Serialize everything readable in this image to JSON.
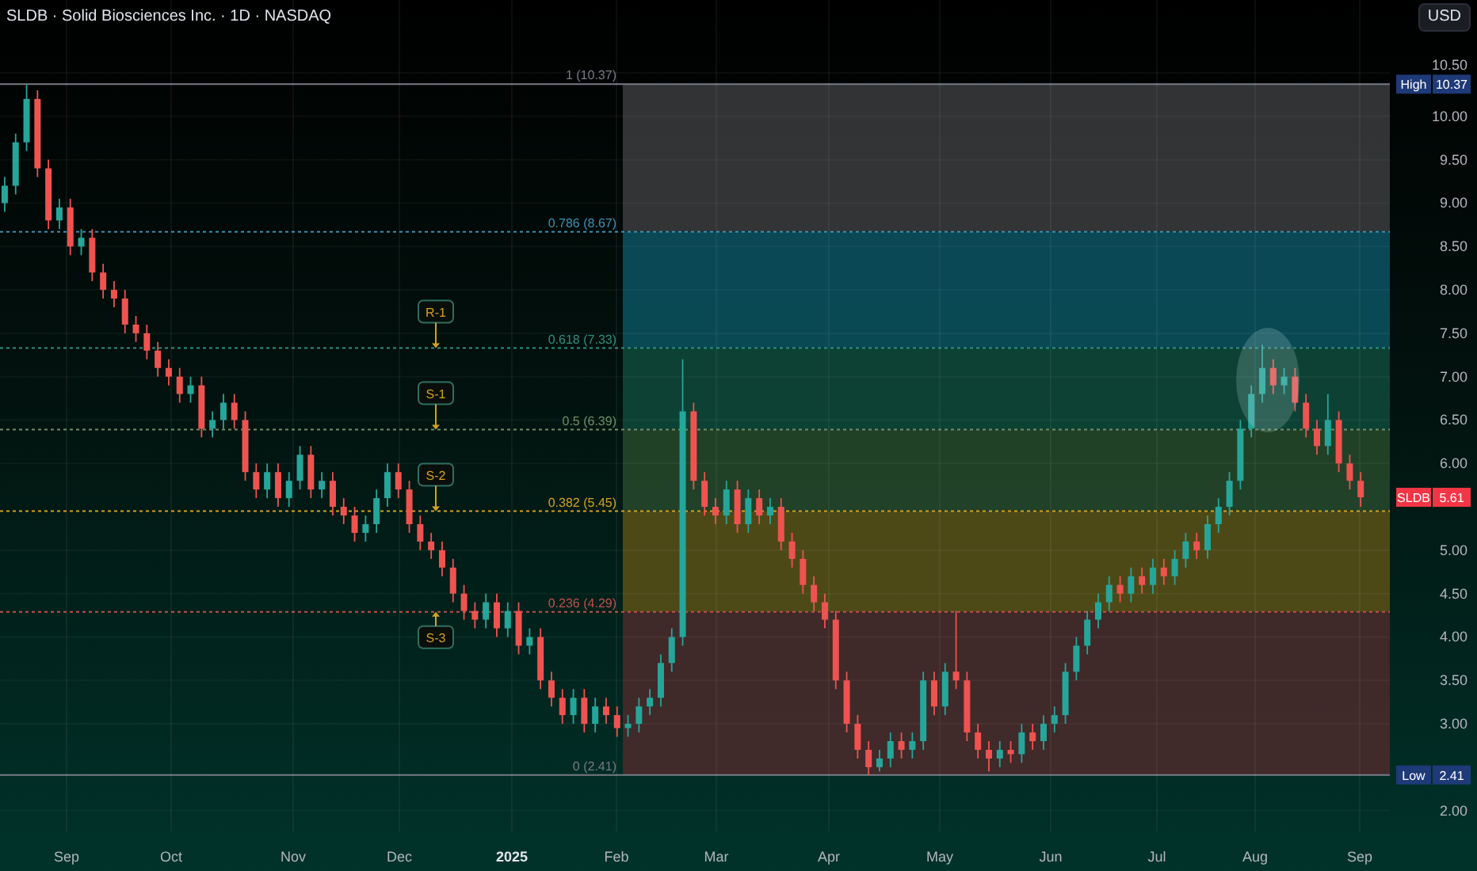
{
  "header": {
    "title": "SLDB · Solid Biosciences Inc. · 1D · NASDAQ",
    "currency_button": "USD"
  },
  "fib_levels": [
    {
      "label": "1 (10.37)",
      "color": "#787b86"
    },
    {
      "label": "0.786 (8.67)",
      "color": "#3d8fb3"
    },
    {
      "label": "0.618 (7.33)",
      "color": "#2f8f7f"
    },
    {
      "label": "0.5 (6.39)",
      "color": "#6f8f6a"
    },
    {
      "label": "0.382 (5.45)",
      "color": "#d3a21f"
    },
    {
      "label": "0.236 (4.29)",
      "color": "#c0504d"
    },
    {
      "label": "0 (2.41)",
      "color": "#787b86"
    }
  ],
  "level_tags": [
    {
      "label": "R-1",
      "arrow_up": false
    },
    {
      "label": "S-1",
      "arrow_up": false
    },
    {
      "label": "S-2",
      "arrow_up": false
    },
    {
      "label": "S-3",
      "arrow_up": true
    }
  ],
  "price_axis": {
    "high": {
      "label": "High",
      "value": "10.37"
    },
    "low": {
      "label": "Low",
      "value": "2.41"
    },
    "last": {
      "label": "SLDB",
      "value": "5.61"
    }
  },
  "time_axis": {
    "ticks": [
      {
        "label": "Sep",
        "bold": false
      },
      {
        "label": "Oct",
        "bold": false
      },
      {
        "label": "Nov",
        "bold": false
      },
      {
        "label": "Dec",
        "bold": false
      },
      {
        "label": "2025",
        "bold": true
      },
      {
        "label": "Feb",
        "bold": false
      },
      {
        "label": "Mar",
        "bold": false
      },
      {
        "label": "Apr",
        "bold": false
      },
      {
        "label": "May",
        "bold": false
      },
      {
        "label": "Jun",
        "bold": false
      },
      {
        "label": "Jul",
        "bold": false
      },
      {
        "label": "Aug",
        "bold": false
      },
      {
        "label": "Sep",
        "bold": false
      }
    ]
  },
  "chart": {
    "chart_data": {
      "type": "candlestick",
      "grid": true,
      "ylim": [
        1.76,
        11.34
      ],
      "categories": [
        null,
        null,
        null,
        null,
        null,
        null,
        null,
        null,
        null,
        null,
        null,
        null,
        null,
        null,
        null,
        null,
        null,
        null,
        null,
        null,
        null,
        null,
        null,
        null,
        null,
        null,
        null,
        null,
        null,
        null,
        null,
        null,
        null,
        null,
        null,
        null,
        null,
        null,
        null,
        null,
        null,
        null,
        null,
        null,
        null,
        null,
        null,
        null,
        null,
        null,
        null,
        null,
        null,
        null,
        null,
        null,
        null,
        null,
        null,
        null,
        null,
        null,
        null,
        null,
        null,
        null,
        null,
        null,
        null,
        null,
        null,
        null,
        null,
        null,
        null,
        null,
        null,
        null,
        null,
        null,
        null,
        null,
        null,
        null,
        null,
        null,
        null,
        null,
        null,
        null,
        null,
        null,
        null,
        null,
        null,
        null,
        null,
        null,
        null,
        null,
        null,
        null,
        null,
        null,
        null,
        null,
        null,
        null,
        null,
        null,
        null,
        null,
        null,
        null,
        null,
        null,
        null,
        null,
        null,
        null,
        null,
        null,
        null,
        null,
        null
      ],
      "ohlc": [
        [
          9.0,
          9.3,
          8.9,
          9.2
        ],
        [
          9.2,
          9.8,
          9.1,
          9.7
        ],
        [
          9.7,
          10.37,
          9.6,
          10.2
        ],
        [
          10.2,
          10.3,
          9.3,
          9.4
        ],
        [
          9.4,
          9.5,
          8.7,
          8.8
        ],
        [
          8.8,
          9.05,
          8.7,
          8.95
        ],
        [
          8.95,
          9.05,
          8.4,
          8.5
        ],
        [
          8.5,
          8.7,
          8.4,
          8.6
        ],
        [
          8.6,
          8.7,
          8.1,
          8.2
        ],
        [
          8.2,
          8.3,
          7.9,
          8.0
        ],
        [
          8.0,
          8.1,
          7.8,
          7.9
        ],
        [
          7.9,
          8.0,
          7.5,
          7.6
        ],
        [
          7.6,
          7.7,
          7.4,
          7.5
        ],
        [
          7.5,
          7.6,
          7.2,
          7.3
        ],
        [
          7.3,
          7.4,
          7.0,
          7.1
        ],
        [
          7.1,
          7.2,
          6.9,
          7.0
        ],
        [
          7.0,
          7.1,
          6.7,
          6.8
        ],
        [
          6.8,
          7.0,
          6.7,
          6.9
        ],
        [
          6.9,
          7.0,
          6.3,
          6.4
        ],
        [
          6.4,
          6.6,
          6.3,
          6.5
        ],
        [
          6.5,
          6.8,
          6.4,
          6.7
        ],
        [
          6.7,
          6.8,
          6.4,
          6.5
        ],
        [
          6.5,
          6.6,
          5.8,
          5.9
        ],
        [
          5.9,
          6.0,
          5.6,
          5.7
        ],
        [
          5.7,
          6.0,
          5.6,
          5.9
        ],
        [
          5.9,
          6.0,
          5.5,
          5.6
        ],
        [
          5.6,
          5.9,
          5.5,
          5.8
        ],
        [
          5.8,
          6.2,
          5.7,
          6.1
        ],
        [
          6.1,
          6.2,
          5.6,
          5.7
        ],
        [
          5.7,
          5.9,
          5.6,
          5.8
        ],
        [
          5.8,
          5.9,
          5.4,
          5.5
        ],
        [
          5.5,
          5.6,
          5.3,
          5.4
        ],
        [
          5.4,
          5.5,
          5.1,
          5.2
        ],
        [
          5.2,
          5.4,
          5.1,
          5.3
        ],
        [
          5.3,
          5.7,
          5.2,
          5.6
        ],
        [
          5.6,
          6.0,
          5.5,
          5.9
        ],
        [
          5.9,
          6.0,
          5.6,
          5.7
        ],
        [
          5.7,
          5.8,
          5.2,
          5.3
        ],
        [
          5.3,
          5.4,
          5.0,
          5.1
        ],
        [
          5.1,
          5.2,
          4.9,
          5.0
        ],
        [
          5.0,
          5.1,
          4.7,
          4.8
        ],
        [
          4.8,
          4.9,
          4.4,
          4.5
        ],
        [
          4.5,
          4.6,
          4.2,
          4.3
        ],
        [
          4.3,
          4.4,
          4.1,
          4.2
        ],
        [
          4.2,
          4.5,
          4.1,
          4.4
        ],
        [
          4.4,
          4.5,
          4.0,
          4.1
        ],
        [
          4.1,
          4.4,
          4.0,
          4.3
        ],
        [
          4.3,
          4.4,
          3.8,
          3.9
        ],
        [
          3.9,
          4.1,
          3.8,
          4.0
        ],
        [
          4.0,
          4.1,
          3.4,
          3.5
        ],
        [
          3.5,
          3.6,
          3.2,
          3.3
        ],
        [
          3.3,
          3.4,
          3.0,
          3.1
        ],
        [
          3.1,
          3.4,
          3.0,
          3.3
        ],
        [
          3.3,
          3.4,
          2.9,
          3.0
        ],
        [
          3.0,
          3.3,
          2.9,
          3.2
        ],
        [
          3.2,
          3.3,
          3.0,
          3.1
        ],
        [
          3.1,
          3.2,
          2.85,
          2.95
        ],
        [
          2.95,
          3.1,
          2.85,
          3.0
        ],
        [
          3.0,
          3.3,
          2.9,
          3.2
        ],
        [
          3.2,
          3.4,
          3.1,
          3.3
        ],
        [
          3.3,
          3.8,
          3.2,
          3.7
        ],
        [
          3.7,
          4.1,
          3.6,
          4.0
        ],
        [
          4.0,
          7.2,
          3.9,
          6.6
        ],
        [
          6.6,
          6.7,
          5.7,
          5.8
        ],
        [
          5.8,
          5.9,
          5.4,
          5.5
        ],
        [
          5.5,
          5.6,
          5.3,
          5.4
        ],
        [
          5.4,
          5.8,
          5.3,
          5.7
        ],
        [
          5.7,
          5.8,
          5.2,
          5.3
        ],
        [
          5.3,
          5.7,
          5.2,
          5.6
        ],
        [
          5.6,
          5.7,
          5.3,
          5.4
        ],
        [
          5.4,
          5.6,
          5.3,
          5.5
        ],
        [
          5.5,
          5.6,
          5.0,
          5.1
        ],
        [
          5.1,
          5.2,
          4.8,
          4.9
        ],
        [
          4.9,
          5.0,
          4.5,
          4.6
        ],
        [
          4.6,
          4.7,
          4.3,
          4.4
        ],
        [
          4.4,
          4.5,
          4.1,
          4.2
        ],
        [
          4.2,
          4.3,
          3.4,
          3.5
        ],
        [
          3.5,
          3.6,
          2.9,
          3.0
        ],
        [
          3.0,
          3.1,
          2.6,
          2.7
        ],
        [
          2.7,
          2.8,
          2.41,
          2.5
        ],
        [
          2.5,
          2.7,
          2.45,
          2.6
        ],
        [
          2.6,
          2.9,
          2.5,
          2.8
        ],
        [
          2.8,
          2.9,
          2.6,
          2.7
        ],
        [
          2.7,
          2.9,
          2.6,
          2.8
        ],
        [
          2.8,
          3.6,
          2.7,
          3.5
        ],
        [
          3.5,
          3.6,
          3.1,
          3.2
        ],
        [
          3.2,
          3.7,
          3.1,
          3.6
        ],
        [
          3.6,
          4.3,
          3.4,
          3.5
        ],
        [
          3.5,
          3.6,
          2.8,
          2.9
        ],
        [
          2.9,
          3.0,
          2.6,
          2.7
        ],
        [
          2.7,
          2.8,
          2.45,
          2.6
        ],
        [
          2.6,
          2.8,
          2.5,
          2.7
        ],
        [
          2.7,
          2.8,
          2.55,
          2.65
        ],
        [
          2.65,
          3.0,
          2.55,
          2.9
        ],
        [
          2.9,
          3.0,
          2.7,
          2.8
        ],
        [
          2.8,
          3.1,
          2.7,
          3.0
        ],
        [
          3.0,
          3.2,
          2.9,
          3.1
        ],
        [
          3.1,
          3.7,
          3.0,
          3.6
        ],
        [
          3.6,
          4.0,
          3.5,
          3.9
        ],
        [
          3.9,
          4.3,
          3.8,
          4.2
        ],
        [
          4.2,
          4.5,
          4.1,
          4.4
        ],
        [
          4.4,
          4.7,
          4.3,
          4.6
        ],
        [
          4.6,
          4.7,
          4.4,
          4.5
        ],
        [
          4.5,
          4.8,
          4.4,
          4.7
        ],
        [
          4.7,
          4.8,
          4.5,
          4.6
        ],
        [
          4.6,
          4.9,
          4.5,
          4.8
        ],
        [
          4.8,
          4.9,
          4.6,
          4.7
        ],
        [
          4.7,
          5.0,
          4.6,
          4.9
        ],
        [
          4.9,
          5.2,
          4.8,
          5.1
        ],
        [
          5.1,
          5.2,
          4.9,
          5.0
        ],
        [
          5.0,
          5.4,
          4.9,
          5.3
        ],
        [
          5.3,
          5.6,
          5.2,
          5.5
        ],
        [
          5.5,
          5.9,
          5.4,
          5.8
        ],
        [
          5.8,
          6.5,
          5.7,
          6.4
        ],
        [
          6.4,
          6.9,
          6.3,
          6.8
        ],
        [
          6.8,
          7.37,
          6.7,
          7.1
        ],
        [
          7.1,
          7.2,
          6.8,
          6.9
        ],
        [
          6.9,
          7.1,
          6.8,
          7.0
        ],
        [
          7.0,
          7.1,
          6.6,
          6.7
        ],
        [
          6.7,
          6.8,
          6.3,
          6.4
        ],
        [
          6.4,
          6.5,
          6.1,
          6.2
        ],
        [
          6.2,
          6.8,
          6.1,
          6.5
        ],
        [
          6.5,
          6.6,
          5.9,
          6.0
        ],
        [
          6.0,
          6.1,
          5.7,
          5.8
        ],
        [
          5.8,
          5.9,
          5.5,
          5.61
        ]
      ],
      "yticks": [
        {
          "value": 10.5,
          "label": "10.50"
        },
        {
          "value": 10,
          "label": "10.00"
        },
        {
          "value": 9.5,
          "label": "9.50"
        },
        {
          "value": 9,
          "label": "9.00"
        },
        {
          "value": 8.5,
          "label": "8.50"
        },
        {
          "value": 8,
          "label": "8.00"
        },
        {
          "value": 7.5,
          "label": "7.50"
        },
        {
          "value": 7,
          "label": "7.00"
        },
        {
          "value": 6.5,
          "label": "6.50"
        },
        {
          "value": 6,
          "label": "6.00"
        },
        {
          "value": 5,
          "label": "5.00"
        },
        {
          "value": 4.5,
          "label": "4.50"
        },
        {
          "value": 4,
          "label": "4.00"
        },
        {
          "value": 3.5,
          "label": "3.50"
        },
        {
          "value": 3,
          "label": "3.00"
        },
        {
          "value": 2,
          "label": "2.00"
        }
      ]
    }
  }
}
